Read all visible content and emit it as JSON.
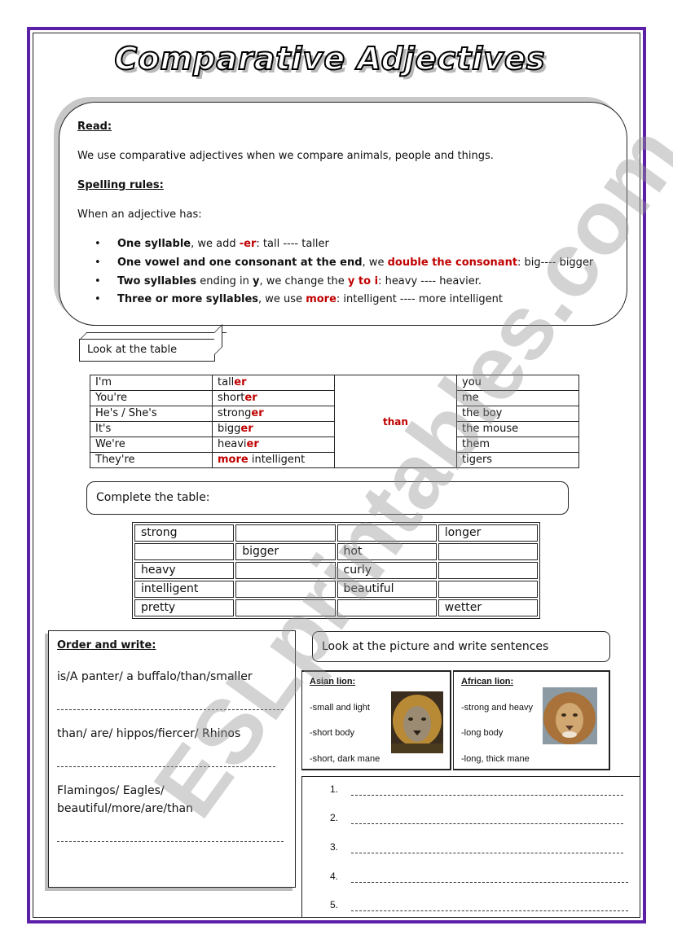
{
  "title": "Comparative Adjectives",
  "read_section": {
    "heading": "Read:",
    "intro": "We use comparative adjectives when we compare animals, people and things.",
    "rules_heading": "Spelling rules:",
    "rules_intro": "When an adjective has:",
    "rules": [
      {
        "bold": "One syllable",
        "mid": ", we add ",
        "red": "-er",
        "rest": ": tall ---- taller"
      },
      {
        "bold": "One vowel and one consonant at the end",
        "mid": ", we ",
        "red": "double the consonant",
        "rest": ": big---- bigger"
      },
      {
        "bold": "Two syllables",
        "mid": " ending in ",
        "bold2": "y",
        "mid2": ", we change the ",
        "red": "y to i",
        "rest": ": heavy ---- heavier."
      },
      {
        "bold": "Three or more syllables",
        "mid": ", we use ",
        "red": "more",
        "rest": ": intelligent ---- more intelligent"
      }
    ]
  },
  "look_table": {
    "label": "Look at the table",
    "connector": "than",
    "rows": [
      {
        "subject": "I'm",
        "stem": "tall",
        "suffix": "er",
        "prefix": "",
        "object": "you"
      },
      {
        "subject": "You're",
        "stem": "short",
        "suffix": "er",
        "prefix": "",
        "object": "me"
      },
      {
        "subject": "He's / She's",
        "stem": "strong",
        "suffix": "er",
        "prefix": "",
        "object": "the boy"
      },
      {
        "subject": "It's",
        "stem": "bigg",
        "suffix": "er",
        "prefix": "",
        "object": "the mouse"
      },
      {
        "subject": "We're",
        "stem": "heavi",
        "suffix": "er",
        "prefix": "",
        "object": "them"
      },
      {
        "subject": "They're",
        "stem": " intelligent",
        "suffix": "",
        "prefix": "more",
        "object": "tigers"
      }
    ]
  },
  "complete_table": {
    "label": "Complete the table:",
    "rows": [
      [
        "strong",
        "",
        "",
        "longer"
      ],
      [
        "",
        "bigger",
        "hot",
        ""
      ],
      [
        "heavy",
        "",
        "curly",
        ""
      ],
      [
        "intelligent",
        "",
        "beautiful",
        ""
      ],
      [
        "pretty",
        "",
        "",
        "wetter"
      ]
    ]
  },
  "order_write": {
    "heading": "Order and write:",
    "items": [
      {
        "line1": "is/A panter/ a buffalo/than/smaller",
        "line2": ""
      },
      {
        "line1": "than/ are/ hippos/fiercer/ Rhinos",
        "line2": ""
      },
      {
        "line1": "Flamingos/ Eagles/",
        "line2": "beautiful/more/are/than"
      }
    ]
  },
  "picture_section": {
    "label": "Look at the picture and write sentences",
    "lions": [
      {
        "name": "Asian lion:",
        "traits": [
          "-small and light",
          "-short body",
          "-short, dark mane"
        ],
        "image": "asian-lion-photo"
      },
      {
        "name": "African lion:",
        "traits": [
          "-strong and heavy",
          "-long body",
          "-long, thick mane"
        ],
        "image": "african-lion-photo"
      }
    ],
    "sentence_numbers": [
      "1.",
      "2.",
      "3.",
      "4.",
      "5."
    ]
  },
  "watermark": "ESLprintables.com",
  "colors": {
    "frame": "#5b1fa8",
    "accent_red": "#c00000"
  }
}
